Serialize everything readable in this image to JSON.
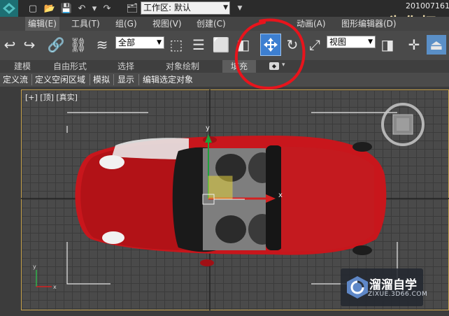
{
  "titlebar": {
    "workspace_label": "工作区: 默认",
    "date_text": "201007161",
    "overlay_caption": "为你打"
  },
  "menus": [
    "编辑(E)",
    "工具(T)",
    "组(G)",
    "视图(V)",
    "创建(C)",
    "动画(A)",
    "图形编辑器(D)"
  ],
  "toolbar": {
    "selection_filter": "全部",
    "reference_coordinate": "视图",
    "active_tool": "move-icon"
  },
  "ribbon": {
    "tabs": [
      "建模",
      "自由形式",
      "选择",
      "对象绘制",
      "填充"
    ],
    "active_tab": "填充"
  },
  "command_bar": [
    "定义流",
    "定义空闲区域",
    "模拟",
    "显示",
    "编辑选定对象"
  ],
  "viewport": {
    "label": "[+] [顶] [真实]",
    "gizmo_x": "x",
    "gizmo_y": "y"
  },
  "brand": {
    "name": "溜溜自学",
    "url": "ZIXUE.3D66.COM"
  },
  "colors": {
    "accent_selected_tool": "#3d7fd1",
    "annotation_circle": "#e8141c",
    "car_body": "#c8161c",
    "viewport_border": "#c9a44d"
  }
}
